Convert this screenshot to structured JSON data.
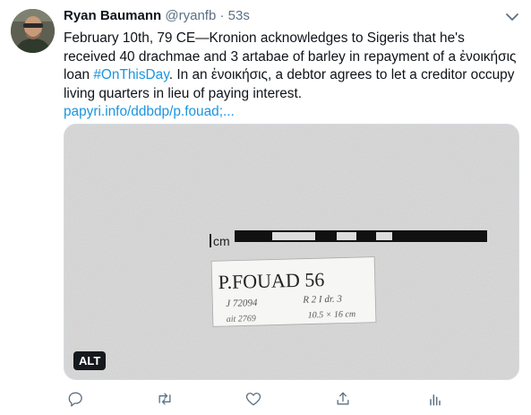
{
  "tweet": {
    "author_name": "Ryan Baumann",
    "handle": "@ryanfb",
    "separator": "·",
    "time": "53s",
    "text_1": "February 10th, 79 CE—Kronion acknowledges to Sigeris that he's received 40 drachmae and 3 artabae of barley in repayment of a ἐνοικήσις loan ",
    "hashtag": "#OnThisDay",
    "text_2": ". In an ἐνοικήσις, a debtor agrees to let a creditor occupy living quarters in lieu of paying interest.",
    "link": "papyri.info/ddbdp/p.fouad;..."
  },
  "media": {
    "alt_badge": "ALT",
    "scale_label": "cm",
    "card_title": "P.FOUAD 56",
    "card_line_1a": "J 72094",
    "card_line_1b": "R 2 I dr. 3",
    "card_line_2a": "ait 2769",
    "card_line_2b": "10.5 × 16 cm"
  },
  "icons": {
    "caret": "chevron-down-icon",
    "reply": "reply-icon",
    "retweet": "retweet-icon",
    "like": "heart-icon",
    "share": "share-icon",
    "analytics": "analytics-icon"
  },
  "colors": {
    "link": "#1b95e0",
    "secondary_text": "#5b7083",
    "icon": "#5b7083"
  }
}
